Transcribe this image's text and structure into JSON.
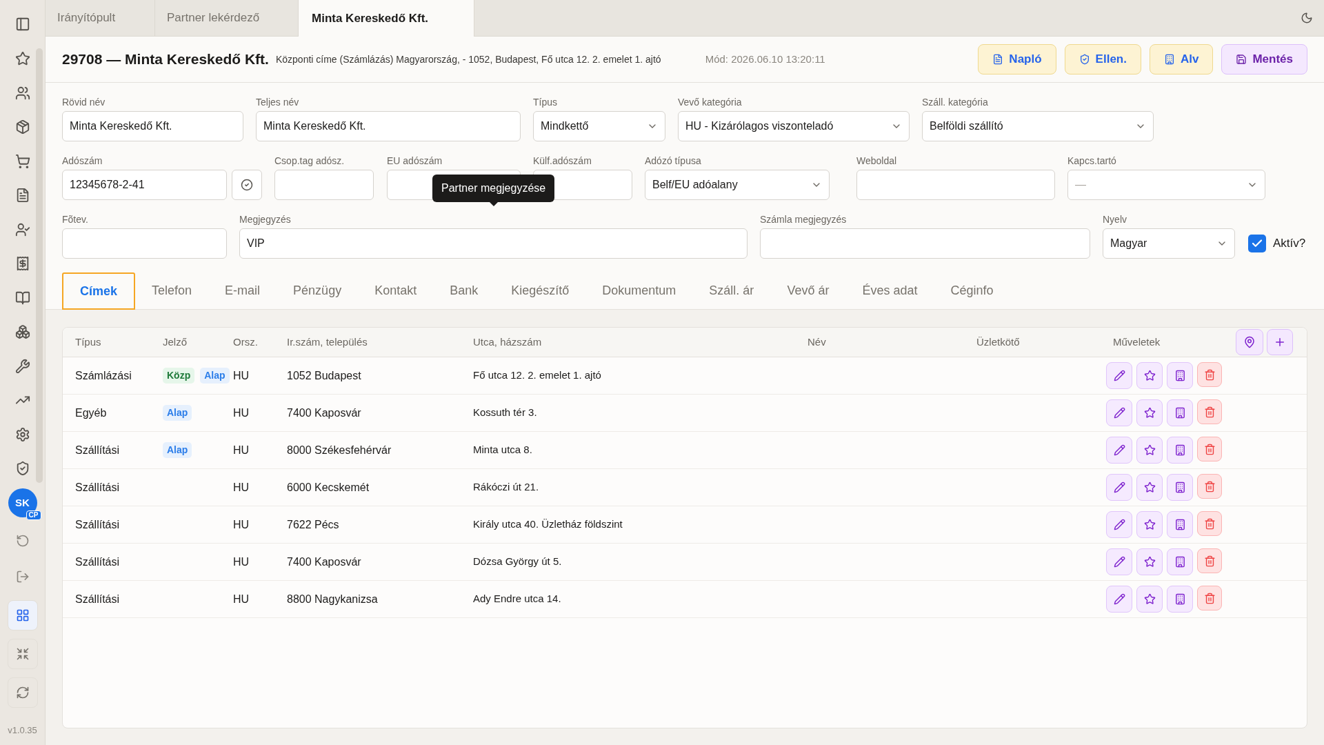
{
  "sidebar": {
    "avatar": {
      "initials": "SK",
      "badge": "CP"
    },
    "tools": [
      {
        "kind": "grid",
        "selected": true
      },
      {
        "kind": "shrink",
        "selected": false
      },
      {
        "kind": "refresh",
        "selected": false
      }
    ],
    "version": "v1.0.35"
  },
  "doc_tabs": [
    {
      "label": "Irányítópult",
      "selected": false
    },
    {
      "label": "Partner lekérdező",
      "selected": false
    },
    {
      "label": "Minta Kereskedő Kft.",
      "selected": true
    }
  ],
  "header": {
    "title": "29708 — Minta Kereskedő Kft.",
    "address": "Központi címe (Számlázás) Magyarország, - 1052, Budapest, Fő utca 12. 2. emelet 1. ajtó",
    "modified": "Mód: 2026.06.10 13:20:11",
    "buttons": [
      {
        "label": "Napló",
        "kind": "log"
      },
      {
        "label": "Ellen.",
        "kind": "check"
      },
      {
        "label": "Alv",
        "kind": "company"
      },
      {
        "label": "Mentés",
        "kind": "save"
      }
    ]
  },
  "form": {
    "fields": [
      {
        "label": "Rövid név",
        "value": "Minta Kereskedő Kft.",
        "kind": "text"
      },
      {
        "label": "Teljes név",
        "value": "Minta Kereskedő Kft.",
        "kind": "text"
      },
      {
        "label": "Típus",
        "value": "Mindkettő",
        "kind": "select"
      },
      {
        "label": "Vevő kategória",
        "value": "HU - Kizárólagos viszonteladó",
        "kind": "select"
      },
      {
        "label": "Száll. kategória",
        "value": "Belföldi szállító",
        "kind": "select"
      },
      {
        "label": "Adószám",
        "value": "12345678-2-41",
        "kind": "validated"
      },
      {
        "label": "Csop.tag adósz.",
        "kind": "text"
      },
      {
        "label": "EU adószám",
        "kind": "text"
      },
      {
        "label": "Külf.adószám",
        "kind": "text"
      },
      {
        "label": "Adózó típusa",
        "value": "Belf/EU adóalany",
        "kind": "select"
      },
      {
        "label": "Weboldal",
        "kind": "text"
      },
      {
        "label": "Kapcs.tartó",
        "placeholder": "—",
        "kind": "select"
      },
      {
        "label": "Fõtev.",
        "kind": "text"
      },
      {
        "label": "Megjegyzés",
        "value": "VIP",
        "kind": "text"
      },
      {
        "label": "Számla megjegyzés",
        "kind": "text"
      },
      {
        "label": "Nyelv",
        "value": "Magyar",
        "kind": "select"
      }
    ],
    "active": {
      "label": "Aktív?",
      "checked": true
    },
    "tooltip": "Partner megjegyzése"
  },
  "section_tabs": [
    {
      "label": "Címek",
      "selected": true
    },
    {
      "label": "Telefon",
      "selected": false
    },
    {
      "label": "E-mail",
      "selected": false
    },
    {
      "label": "Pénzügy",
      "selected": false
    },
    {
      "label": "Kontakt",
      "selected": false
    },
    {
      "label": "Bank",
      "selected": false
    },
    {
      "label": "Kiegészítő",
      "selected": false
    },
    {
      "label": "Dokumentum",
      "selected": false
    },
    {
      "label": "Száll. ár",
      "selected": false
    },
    {
      "label": "Vevő ár",
      "selected": false
    },
    {
      "label": "Éves adat",
      "selected": false
    },
    {
      "label": "Céginfo",
      "selected": false
    }
  ],
  "table": {
    "columns": [
      "Típus",
      "Jelző",
      "Orsz.",
      "Ir.szám, település",
      "Utca, házszám",
      "Név",
      "Üzletkötő",
      "Műveletek"
    ],
    "rows": [
      {
        "type": "Számlázási",
        "badges": [
          {
            "label": "Közp",
            "kind": "central"
          },
          {
            "label": "Alap",
            "kind": "default"
          }
        ],
        "country": "HU",
        "city": "1052 Budapest",
        "street": "Fő utca 12. 2. emelet 1. ajtó"
      },
      {
        "type": "Egyéb",
        "badges": [
          {
            "label": "Alap",
            "kind": "default"
          }
        ],
        "country": "HU",
        "city": "7400 Kaposvár",
        "street": "Kossuth tér 3."
      },
      {
        "type": "Szállítási",
        "badges": [
          {
            "label": "Alap",
            "kind": "default"
          }
        ],
        "country": "HU",
        "city": "8000 Székesfehérvár",
        "street": "Minta utca 8."
      },
      {
        "type": "Szállítási",
        "country": "HU",
        "city": "6000 Kecskemét",
        "street": "Rákóczi út 21."
      },
      {
        "type": "Szállítási",
        "country": "HU",
        "city": "7622 Pécs",
        "street": "Király utca 40. Üzletház földszint"
      },
      {
        "type": "Szállítási",
        "country": "HU",
        "city": "7400 Kaposvár",
        "street": "Dózsa György út 5."
      },
      {
        "type": "Szállítási",
        "country": "HU",
        "city": "8800 Nagykanizsa",
        "street": "Ady Endre utca 14."
      }
    ]
  }
}
